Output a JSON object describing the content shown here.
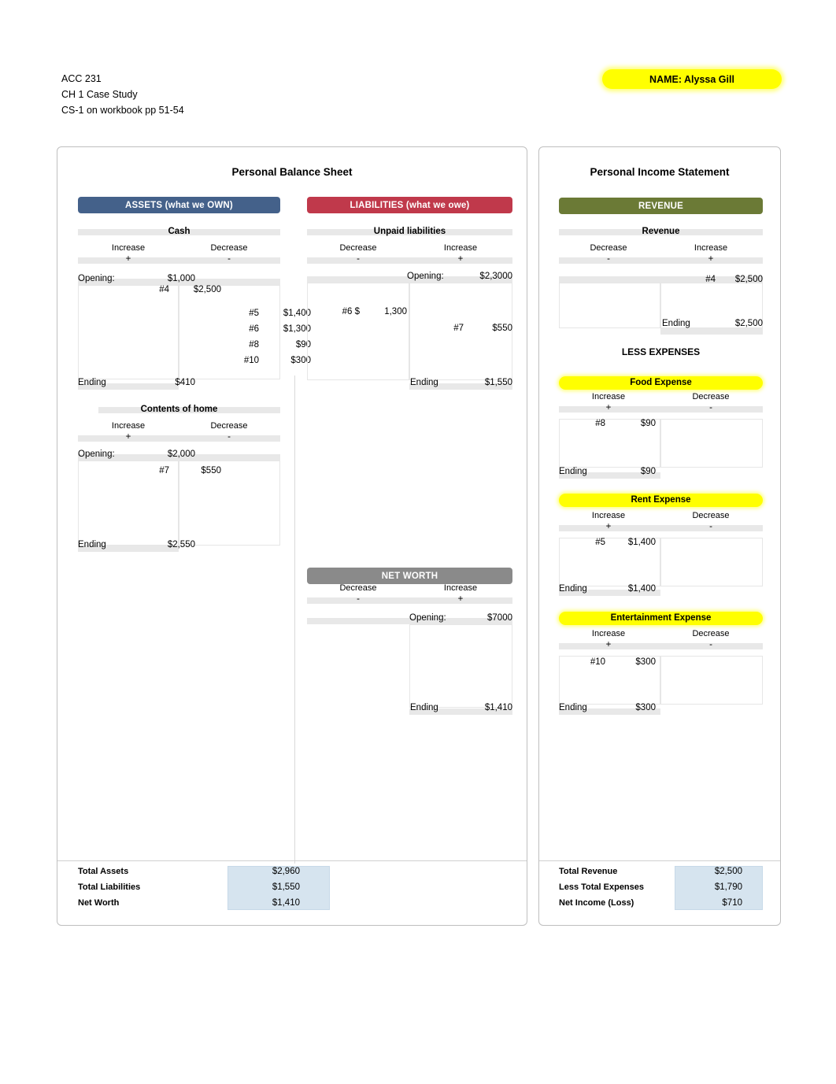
{
  "header": {
    "line1": "ACC 231",
    "line2": "CH 1 Case Study",
    "line3": "CS-1 on workbook pp 51-54",
    "name_label": "NAME: Alyssa Gill"
  },
  "balance_sheet": {
    "title": "Personal Balance Sheet",
    "assets_band": "ASSETS (what we OWN)",
    "liabilities_band": "LIABILITIES (what we owe)",
    "networth_band": "NET WORTH",
    "cash": {
      "title": "Cash",
      "col_left": "Increase",
      "col_right": "Decrease",
      "sign_left": "+",
      "sign_right": "-",
      "opening_label": "Opening:",
      "opening_value": "$1,000",
      "left_entries": [
        {
          "ref": "#4",
          "amount": "$2,500"
        }
      ],
      "right_entries": [
        {
          "ref": "#5",
          "amount": "$1,400"
        },
        {
          "ref": "#6",
          "amount": "$1,300"
        },
        {
          "ref": "#8",
          "amount": "$90"
        },
        {
          "ref": "#10",
          "amount": "$300"
        }
      ],
      "ending_label": "Ending",
      "ending_value": "$410"
    },
    "contents": {
      "title": "Contents of home",
      "col_left": "Increase",
      "col_right": "Decrease",
      "sign_left": "+",
      "sign_right": "-",
      "opening_label": "Opening:",
      "opening_value": "$2,000",
      "left_entries": [
        {
          "ref": "#7",
          "amount": "$550"
        }
      ],
      "ending_label": "Ending",
      "ending_value": "$2,550"
    },
    "unpaid": {
      "title": "Unpaid liabilities",
      "col_left": "Decrease",
      "col_right": "Increase",
      "sign_left": "-",
      "sign_right": "+",
      "opening_label": "Opening:",
      "opening_value": "$2,3000",
      "left_entries": [
        {
          "ref": "#6  $",
          "amount": "1,300"
        }
      ],
      "right_entries": [
        {
          "ref": "#7",
          "amount": "$550"
        }
      ],
      "ending_label": "Ending",
      "ending_value": "$1,550"
    },
    "networth": {
      "col_left": "Decrease",
      "col_right": "Increase",
      "sign_left": "-",
      "sign_right": "+",
      "opening_label": "Opening:",
      "opening_value": "$7000",
      "ending_label": "Ending",
      "ending_value": "$1,410"
    },
    "totals": [
      {
        "label": "Total Assets",
        "value": "$2,960"
      },
      {
        "label": "Total Liabilities",
        "value": "$1,550"
      },
      {
        "label": "Net Worth",
        "value": "$1,410"
      }
    ]
  },
  "income_statement": {
    "title": "Personal Income Statement",
    "revenue_band": "REVENUE",
    "less_expenses": "LESS EXPENSES",
    "revenue": {
      "title": "Revenue",
      "col_left": "Decrease",
      "col_right": "Increase",
      "sign_left": "-",
      "sign_right": "+",
      "right_entries": [
        {
          "ref": "#4",
          "amount": "$2,500"
        }
      ],
      "ending_label": "Ending",
      "ending_value": "$2,500"
    },
    "food": {
      "title": "Food Expense",
      "col_left": "Increase",
      "col_right": "Decrease",
      "sign_left": "+",
      "sign_right": "-",
      "left_entries": [
        {
          "ref": "#8",
          "amount": "$90"
        }
      ],
      "ending_label": "Ending",
      "ending_value": "$90"
    },
    "rent": {
      "title": "Rent Expense",
      "col_left": "Increase",
      "col_right": "Decrease",
      "sign_left": "+",
      "sign_right": "-",
      "left_entries": [
        {
          "ref": "#5",
          "amount": "$1,400"
        }
      ],
      "ending_label": "Ending",
      "ending_value": "$1,400"
    },
    "entertainment": {
      "title": "Entertainment Expense",
      "col_left": "Increase",
      "col_right": "Decrease",
      "sign_left": "+",
      "sign_right": "-",
      "left_entries": [
        {
          "ref": "#10",
          "amount": "$300"
        }
      ],
      "ending_label": "Ending",
      "ending_value": "$300"
    },
    "totals": [
      {
        "label": "Total Revenue",
        "value": "$2,500"
      },
      {
        "label": "Less Total Expenses",
        "value": "$1,790"
      },
      {
        "label": "Net Income (Loss)",
        "value": "$710"
      }
    ]
  }
}
